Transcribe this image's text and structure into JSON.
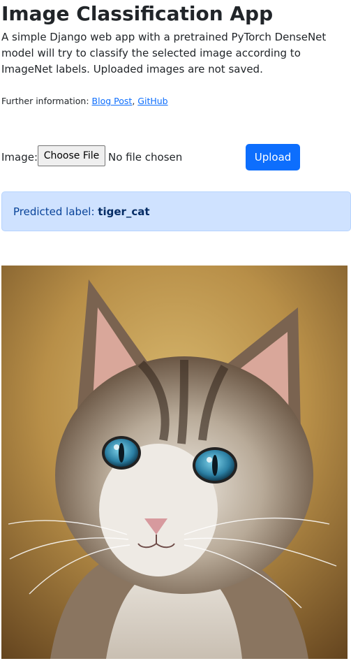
{
  "header": {
    "title": "Image Classification App"
  },
  "intro": {
    "text": "A simple Django web app with a pretrained PyTorch DenseNet model will try to classify the selected image according to ImageNet labels. Uploaded images are not saved."
  },
  "further_info": {
    "label": "Further information:",
    "links": [
      {
        "text": "Blog Post"
      },
      {
        "text": "GitHub"
      }
    ],
    "separator": ","
  },
  "form": {
    "image_label": "Image:",
    "choose_file_label": "Choose File",
    "no_file_text": "No file chosen",
    "upload_label": "Upload"
  },
  "prediction": {
    "label": "Predicted label:",
    "value": "tiger_cat"
  },
  "colors": {
    "primary": "#0d6efd",
    "alert_bg": "#cfe2ff",
    "alert_text": "#084298"
  }
}
